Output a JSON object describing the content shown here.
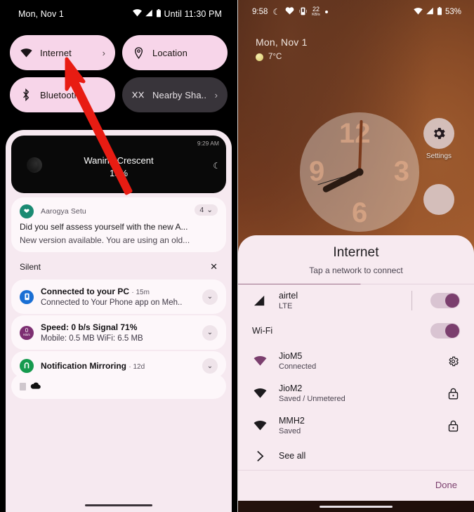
{
  "left_panel": {
    "statusbar": {
      "date": "Mon, Nov 1",
      "battery_text": "Until 11:30 PM",
      "icons": [
        "wifi-icon",
        "cellular-signal-icon",
        "battery-icon"
      ]
    },
    "quick_settings": [
      {
        "label": "Internet",
        "icon": "wifi-icon",
        "state": "on",
        "has_chevron": true
      },
      {
        "label": "Location",
        "icon": "location-pin-icon",
        "state": "on",
        "has_chevron": false
      },
      {
        "label": "Bluetooth",
        "icon": "bluetooth-icon",
        "state": "on",
        "has_chevron": false
      },
      {
        "label": "Nearby Sha..",
        "icon": "nearby-share-icon",
        "state": "off",
        "has_chevron": true
      }
    ],
    "moon_widget": {
      "time": "9:29 AM",
      "title": "Waning Crescent",
      "percent": "15%"
    },
    "notifications": [
      {
        "app": "Aarogya Setu",
        "badge_count": "4",
        "line1": "Did you self assess yourself with the new A...",
        "line2": "New version available. You are using an old..."
      }
    ],
    "silent_section": {
      "title": "Silent",
      "close_label": "✕",
      "items": [
        {
          "title": "Connected to your PC",
          "time": "15m",
          "subtitle": "Connected to Your Phone app on Meh..",
          "icon": "phone-link-icon"
        },
        {
          "title": "Speed: 0 b/s    Signal 71%",
          "time": "",
          "subtitle": "Mobile: 0.5 MB   WiFi: 6.5 MB",
          "icon": "speed-meter-icon",
          "icon_text": "0",
          "icon_unit": "KB/s"
        },
        {
          "title": "Notification Mirroring",
          "time": "12d",
          "subtitle": "",
          "icon": "notification-mirroring-icon"
        }
      ]
    },
    "annotation": {
      "type": "red-arrow",
      "color": "#e81c13",
      "points_to": "Internet tile"
    }
  },
  "right_panel": {
    "statusbar": {
      "time": "9:58",
      "left_icons": [
        "crescent-moon-icon",
        "heart-icon",
        "phone-cast-icon",
        "data-speed-icon",
        "dot-icon"
      ],
      "data_speed_value": "22",
      "data_speed_unit": "KB/s",
      "battery_percent": "53%",
      "right_icons": [
        "wifi-icon",
        "cellular-signal-icon",
        "battery-icon"
      ]
    },
    "home": {
      "date": "Mon, Nov 1",
      "temperature": "7°C",
      "weather_icon": "sun-icon",
      "clock_numerals": [
        "12",
        "3",
        "6",
        "9"
      ],
      "app_shortcut": {
        "label": "Settings",
        "icon": "gear-icon"
      }
    },
    "internet_sheet": {
      "title": "Internet",
      "subtitle": "Tap a network to connect",
      "mobile": {
        "name": "airtel",
        "type": "LTE",
        "icon": "cellular-signal-icon",
        "toggle_on": true
      },
      "wifi": {
        "label": "Wi-Fi",
        "toggle_on": true
      },
      "networks": [
        {
          "name": "JioM5",
          "status": "Connected",
          "icon": "wifi-icon",
          "icon_active": true,
          "trailing_icon": "gear-icon"
        },
        {
          "name": "JioM2",
          "status": "Saved / Unmetered",
          "icon": "wifi-icon",
          "icon_active": false,
          "trailing_icon": "lock-icon"
        },
        {
          "name": "MMH2",
          "status": "Saved",
          "icon": "wifi-icon",
          "icon_active": false,
          "trailing_icon": "lock-icon"
        }
      ],
      "see_all": {
        "label": "See all",
        "icon": "chevron-right-icon"
      },
      "done_label": "Done"
    }
  },
  "colors": {
    "accent_purple": "#7b3f6e",
    "tile_active": "#f7d5e9",
    "tile_inactive": "#38343a",
    "sheet_bg": "#f7eaf0",
    "arrow_red": "#e81c13"
  }
}
